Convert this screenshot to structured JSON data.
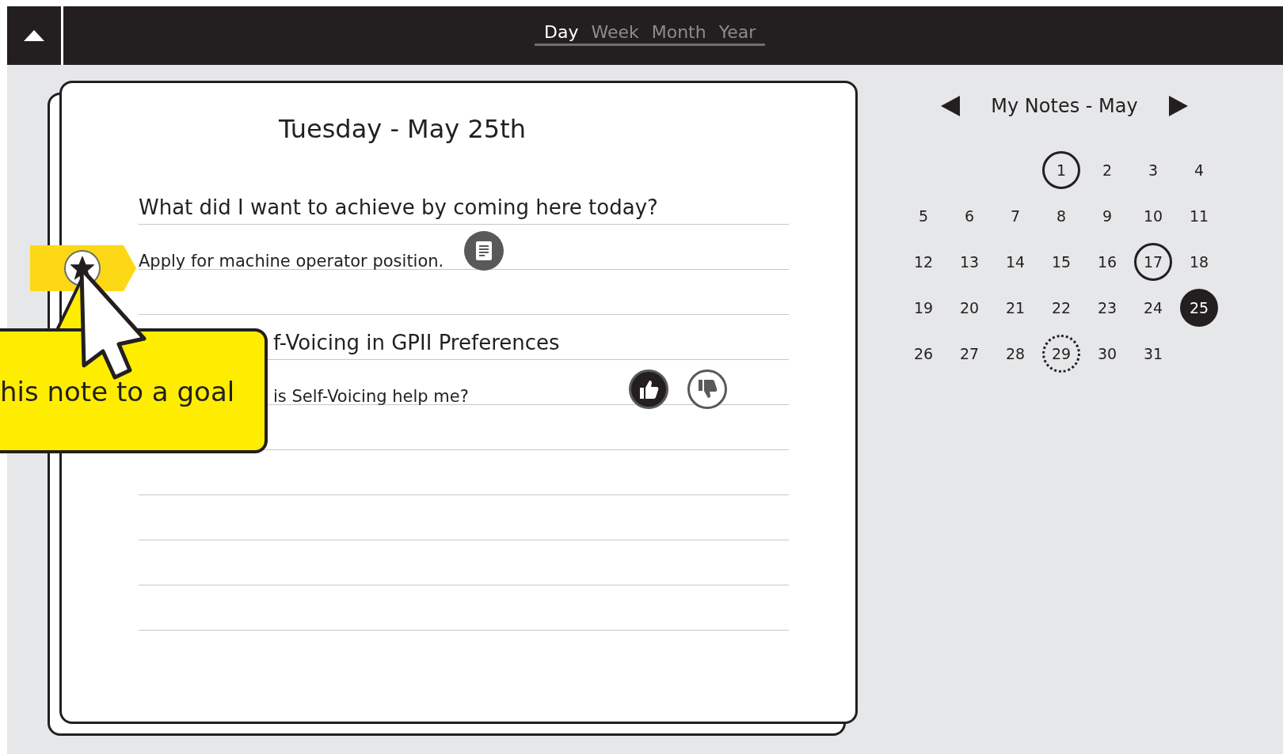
{
  "tabs": [
    {
      "label": "Day",
      "selected": true
    },
    {
      "label": "Week",
      "selected": false
    },
    {
      "label": "Month",
      "selected": false
    },
    {
      "label": "Year",
      "selected": false
    }
  ],
  "page": {
    "title": "Tuesday - May 25th",
    "sections": [
      {
        "heading": "What did I want to achieve by coming here today?",
        "entries": [
          {
            "text": "Apply for machine operator position.",
            "kind": "note"
          }
        ]
      },
      {
        "heading": "f-Voicing in GPII Preferences",
        "entries": [
          {
            "text": "is Self-Voicing help me?",
            "kind": "rating",
            "liked": true,
            "disliked": false
          }
        ]
      }
    ]
  },
  "goal_tag": {
    "starred": true
  },
  "tooltip": {
    "text": "his note to a goal"
  },
  "calendar": {
    "title": "My Notes - May",
    "weeks": [
      [
        {
          "day": "1",
          "ringed": true,
          "dotted": false,
          "selected": false
        },
        {
          "day": "2",
          "ringed": false,
          "dotted": false,
          "selected": false
        },
        {
          "day": "3",
          "ringed": false,
          "dotted": false,
          "selected": false
        },
        {
          "day": "4",
          "ringed": false,
          "dotted": false,
          "selected": false
        }
      ],
      [
        {
          "day": "5",
          "ringed": false,
          "dotted": false,
          "selected": false
        },
        {
          "day": "6",
          "ringed": false,
          "dotted": false,
          "selected": false
        },
        {
          "day": "7",
          "ringed": false,
          "dotted": false,
          "selected": false
        },
        {
          "day": "8",
          "ringed": false,
          "dotted": false,
          "selected": false
        },
        {
          "day": "9",
          "ringed": false,
          "dotted": false,
          "selected": false
        },
        {
          "day": "10",
          "ringed": false,
          "dotted": false,
          "selected": false
        },
        {
          "day": "11",
          "ringed": false,
          "dotted": false,
          "selected": false
        }
      ],
      [
        {
          "day": "12",
          "ringed": false,
          "dotted": false,
          "selected": false
        },
        {
          "day": "13",
          "ringed": false,
          "dotted": false,
          "selected": false
        },
        {
          "day": "14",
          "ringed": false,
          "dotted": false,
          "selected": false
        },
        {
          "day": "15",
          "ringed": false,
          "dotted": false,
          "selected": false
        },
        {
          "day": "16",
          "ringed": false,
          "dotted": false,
          "selected": false
        },
        {
          "day": "17",
          "ringed": true,
          "dotted": false,
          "selected": false
        },
        {
          "day": "18",
          "ringed": false,
          "dotted": false,
          "selected": false
        }
      ],
      [
        {
          "day": "19",
          "ringed": false,
          "dotted": false,
          "selected": false
        },
        {
          "day": "20",
          "ringed": false,
          "dotted": false,
          "selected": false
        },
        {
          "day": "21",
          "ringed": false,
          "dotted": false,
          "selected": false
        },
        {
          "day": "22",
          "ringed": false,
          "dotted": false,
          "selected": false
        },
        {
          "day": "23",
          "ringed": false,
          "dotted": false,
          "selected": false
        },
        {
          "day": "24",
          "ringed": false,
          "dotted": false,
          "selected": false
        },
        {
          "day": "25",
          "ringed": false,
          "dotted": false,
          "selected": true
        }
      ],
      [
        {
          "day": "26",
          "ringed": false,
          "dotted": false,
          "selected": false
        },
        {
          "day": "27",
          "ringed": false,
          "dotted": false,
          "selected": false
        },
        {
          "day": "28",
          "ringed": false,
          "dotted": false,
          "selected": false
        },
        {
          "day": "29",
          "ringed": false,
          "dotted": true,
          "selected": false
        },
        {
          "day": "30",
          "ringed": false,
          "dotted": false,
          "selected": false
        },
        {
          "day": "31",
          "ringed": false,
          "dotted": false,
          "selected": false
        }
      ]
    ]
  }
}
